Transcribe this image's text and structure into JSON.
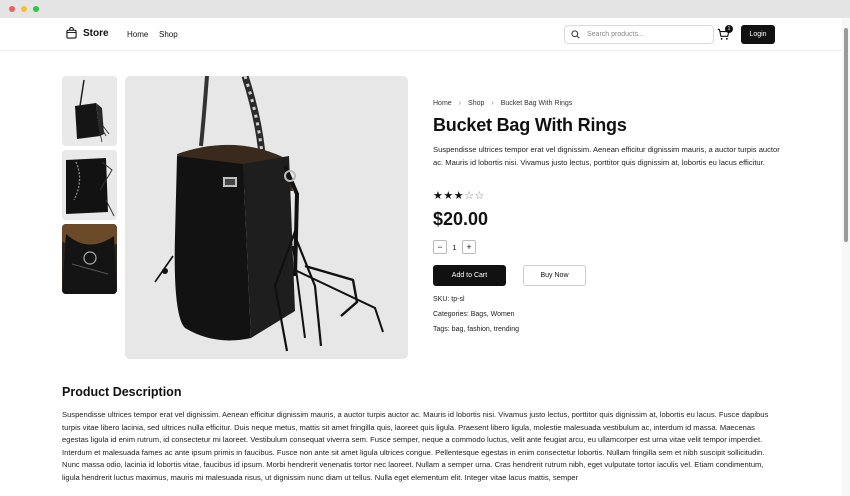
{
  "header": {
    "logo_text": "Store",
    "nav": {
      "home": "Home",
      "shop": "Shop"
    },
    "search_placeholder": "Search products...",
    "cart_count": "1",
    "login_label": "Login"
  },
  "breadcrumb": {
    "home": "Home",
    "shop": "Shop",
    "current": "Bucket Bag With Rings"
  },
  "product": {
    "title": "Bucket Bag With Rings",
    "short_description": "Suspendisse ultrices tempor erat vel dignissim. Aenean efficitur dignissim mauris, a auctor turpis auctor ac. Mauris id lobortis nisi. Vivamus justo lectus, porttitor quis dignissim at, lobortis eu lacus efficitur.",
    "rating": 3,
    "rating_max": 5,
    "price": "$20.00",
    "quantity": "1",
    "add_to_cart_label": "Add to Cart",
    "buy_now_label": "Buy Now",
    "sku": "SKU: tp-sl",
    "categories": "Categories: Bags, Women",
    "tags": "Tags: bag, fashion, trending"
  },
  "description": {
    "heading": "Product Description",
    "paragraph_1": "Suspendisse ultrices tempor erat vel dignissim. Aenean efficitur dignissim mauris, a auctor turpis auctor ac. Mauris id lobortis nisi. Vivamus justo lectus, porttitor quis dignissim at, lobortis eu lacus. Fusce dapibus turpis vitae libero lacinia, sed ultrices nulla efficitur. Duis neque metus, mattis sit amet fringilla quis, laoreet quis ligula. Praesent libero ligula, molestie malesuada vestibulum ac, interdum id massa. Maecenas egestas ligula id enim rutrum, id consectetur mi laoreet. Vestibulum consequat viverra sem. Fusce semper, neque a commodo luctus, velit ante feugiat arcu, eu ullamcorper est urna vitae velit tempor imperdiet.",
    "paragraph_2": "Interdum et malesuada fames ac ante ipsum primis in faucibus. Fusce non ante sit amet ligula ultrices congue. Pellentesque egestas in enim consectetur lobortis. Nullam fringilla sem et nibh suscipit sollicitudin. Nunc massa odio, lacinia id lobortis vitae, faucibus id ipsum. Morbi hendrerit venenatis tortor nec laoreet. Nullam a semper urna. Cras hendrerit rutrum nibh, eget vulputate tortor iaculis vel. Etiam condimentum, ligula hendrerit luctus maximus, mauris mi malesuada risus, ut dignissim nunc diam ut tellus. Nulla eget elementum elit. Integer vitae lacus mattis, semper"
  },
  "icons": {
    "logo": "bag-icon",
    "search": "search-icon",
    "cart": "cart-icon",
    "breadcrumb_separator": "chevron-right-icon",
    "star_full": "star-filled-icon",
    "star_empty": "star-outline-icon"
  },
  "colors": {
    "primary": "#111111",
    "image_background": "#e7e7e7",
    "border": "#d9d9d9"
  }
}
